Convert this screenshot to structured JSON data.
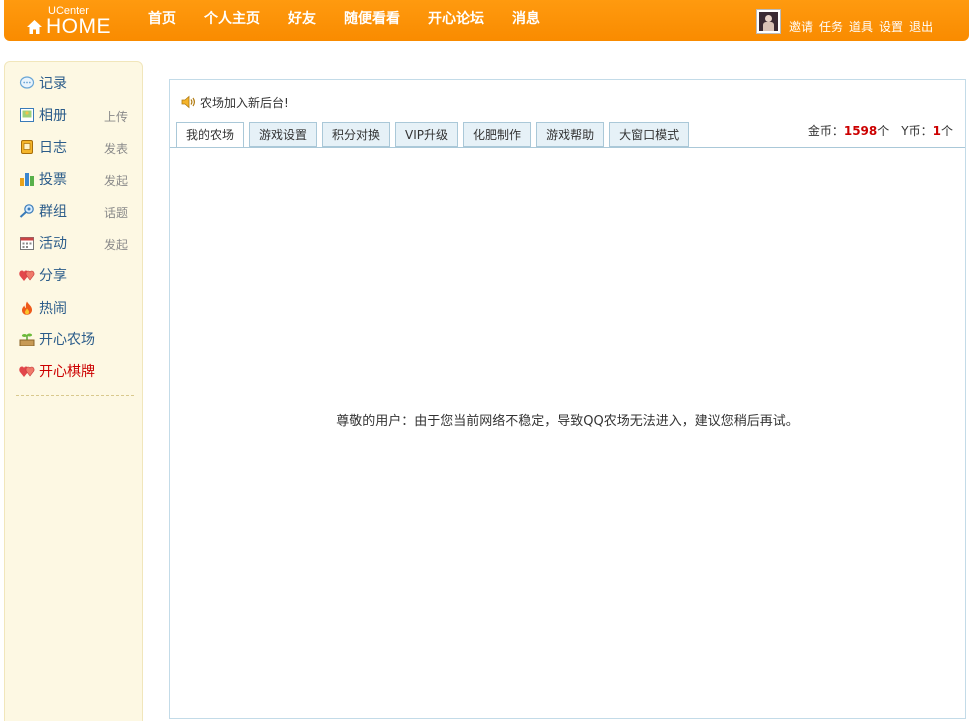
{
  "header": {
    "logo_small": "UCenter",
    "logo_big": "HOME",
    "nav": [
      "首页",
      "个人主页",
      "好友",
      "随便看看",
      "开心论坛",
      "消息"
    ],
    "user_links": [
      "邀请",
      "任务",
      "道具",
      "设置",
      "退出"
    ]
  },
  "sidebar": {
    "items": [
      {
        "icon": "speech-bubble-icon",
        "label": "记录",
        "action": ""
      },
      {
        "icon": "photo-album-icon",
        "label": "相册",
        "action": "上传"
      },
      {
        "icon": "diary-icon",
        "label": "日志",
        "action": "发表"
      },
      {
        "icon": "bar-chart-icon",
        "label": "投票",
        "action": "发起"
      },
      {
        "icon": "group-icon",
        "label": "群组",
        "action": "话题"
      },
      {
        "icon": "calendar-icon",
        "label": "活动",
        "action": "发起"
      },
      {
        "icon": "hearts-icon",
        "label": "分享",
        "action": ""
      },
      {
        "icon": "flame-icon",
        "label": "热闹",
        "action": ""
      },
      {
        "icon": "farm-icon",
        "label": "开心农场",
        "action": ""
      },
      {
        "icon": "hearts-icon",
        "label": "开心棋牌",
        "action": ""
      }
    ]
  },
  "main": {
    "notice": "农场加入新后台!",
    "tabs": [
      "我的农场",
      "游戏设置",
      "积分对换",
      "VIP升级",
      "化肥制作",
      "游戏帮助",
      "大窗口模式"
    ],
    "active_tab": 0,
    "coins": {
      "gold_label": "金币：",
      "gold_value": "1598",
      "gold_unit": "个",
      "y_label": "Y币：",
      "y_value": "1",
      "y_unit": "个"
    },
    "message": "尊敬的用户：由于您当前网络不稳定，导致QQ农场无法进入，建议您稍后再试。"
  },
  "colors": {
    "topbar": "#f98b00",
    "sidebar_bg": "#fdf8e3",
    "link_blue": "#2b5c8a",
    "highlight_red": "#cc0000"
  }
}
